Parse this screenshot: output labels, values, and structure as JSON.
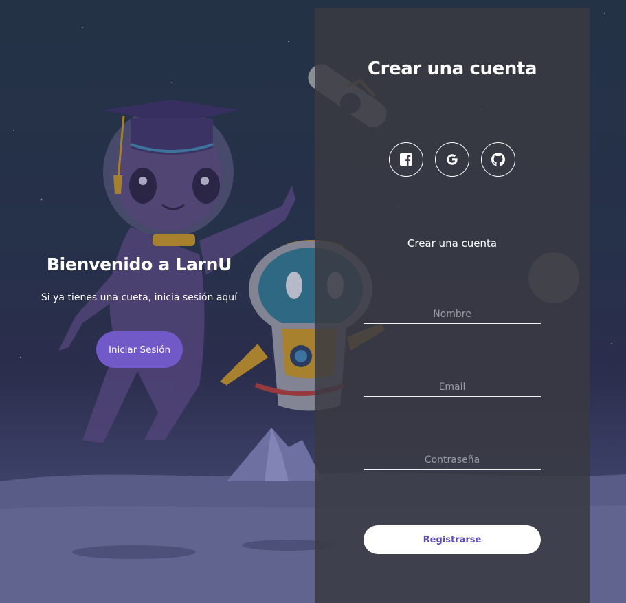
{
  "welcome": {
    "title": "Bienvenido a LarnU",
    "text": "Si ya tienes una cueta, inicia sesión aquí",
    "login_button": "Iniciar Sesión"
  },
  "signup": {
    "title": "Crear una cuenta",
    "subtitle": "Crear una cuenta",
    "social": [
      "facebook-icon",
      "google-icon",
      "github-icon"
    ],
    "name_placeholder": "Nombre",
    "email_placeholder": "Email",
    "password_placeholder": "Contraseña",
    "register_button": "Registrarse"
  },
  "colors": {
    "accent": "#7159c8",
    "panel": "#3a3a42",
    "register_text": "#5b4ab8"
  }
}
